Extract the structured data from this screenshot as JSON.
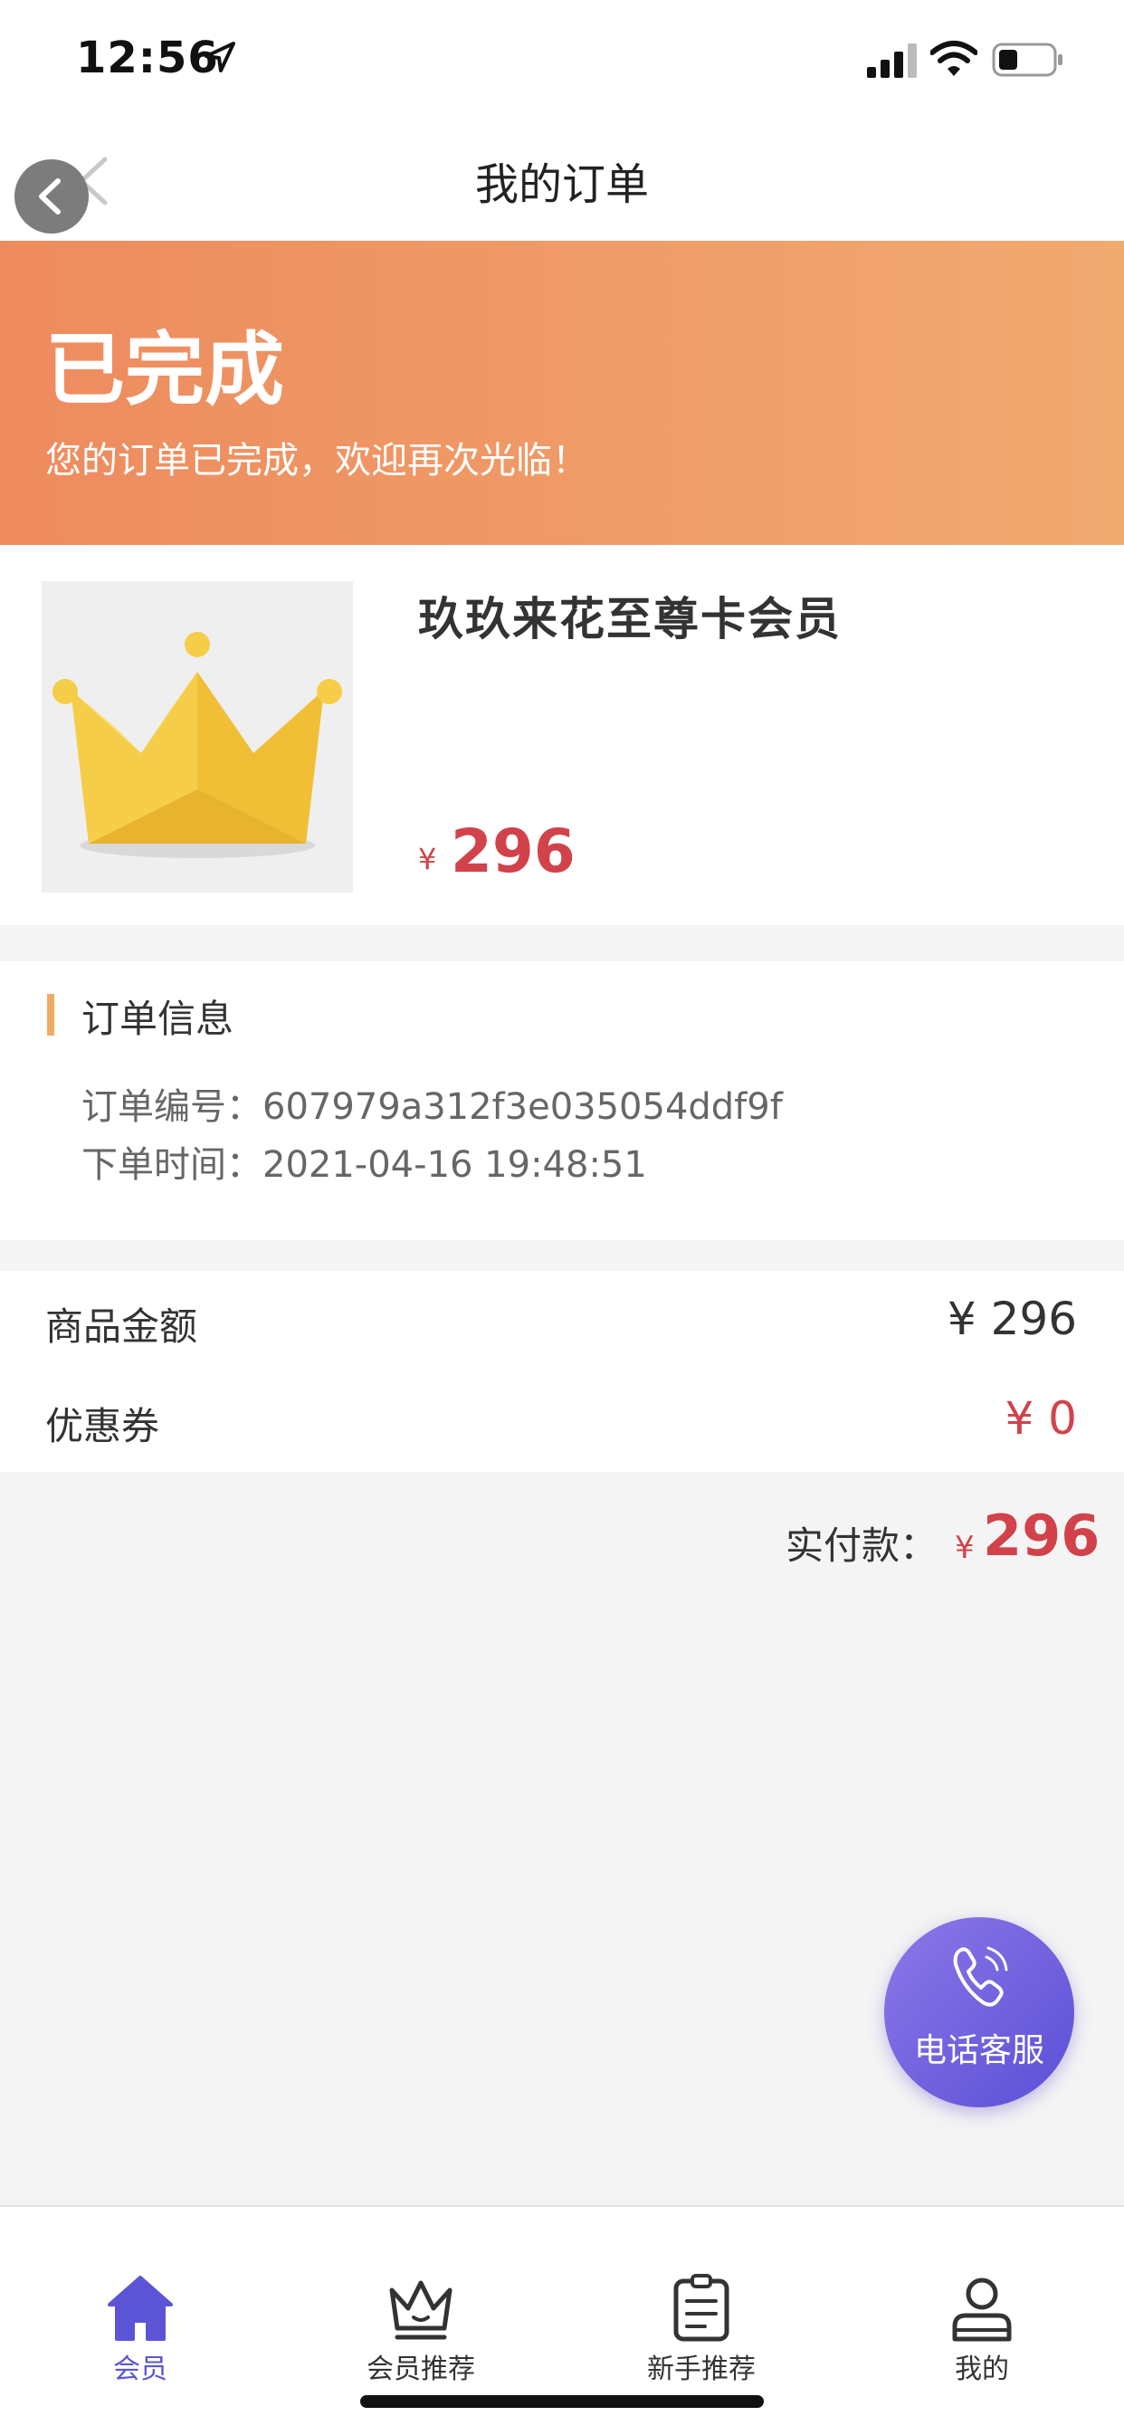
{
  "status_bar": {
    "time": "12:56"
  },
  "nav": {
    "title": "我的订单"
  },
  "banner": {
    "title": "已完成",
    "subtitle": "您的订单已完成，欢迎再次光临！"
  },
  "product": {
    "name": "玖玖来花至尊卡会员",
    "currency": "¥",
    "price": "296"
  },
  "order_info": {
    "heading": "订单信息",
    "number_label": "订单编号：",
    "number_value": "607979a312f3e035054ddf9f",
    "time_label": "下单时间：",
    "time_value": "2021-04-16 19:48:51"
  },
  "amounts": {
    "goods_label": "商品金额",
    "goods_value": "¥ 296",
    "coupon_label": "优惠券",
    "coupon_value": "¥ 0"
  },
  "paid": {
    "label": "实付款：",
    "currency": "¥",
    "value": "296"
  },
  "call_button": {
    "label": "电话客服"
  },
  "tabs": [
    {
      "label": "会员",
      "icon": "home-icon",
      "active": true
    },
    {
      "label": "会员推荐",
      "icon": "crown-icon",
      "active": false
    },
    {
      "label": "新手推荐",
      "icon": "clipboard-icon",
      "active": false
    },
    {
      "label": "我的",
      "icon": "user-icon",
      "active": false
    }
  ],
  "colors": {
    "accent": "#5b55d6",
    "price": "#d2424a",
    "banner_start": "#ee8b5e",
    "banner_end": "#f0aa70"
  }
}
